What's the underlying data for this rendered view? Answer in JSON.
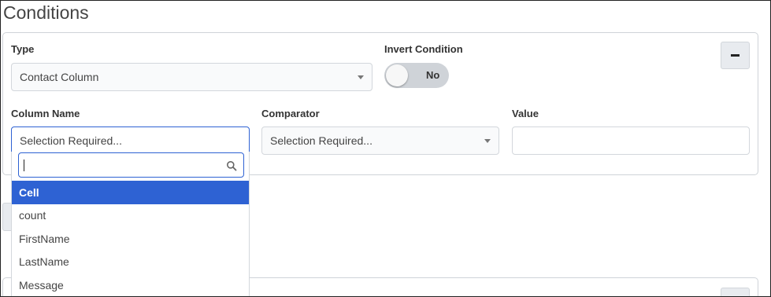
{
  "page": {
    "title": "Conditions"
  },
  "condition": {
    "type_label": "Type",
    "type_value": "Contact Column",
    "invert_label": "Invert Condition",
    "invert_value": "No",
    "column_name_label": "Column Name",
    "column_name_value": "Selection Required...",
    "comparator_label": "Comparator",
    "comparator_value": "Selection Required...",
    "value_label": "Value",
    "value_value": ""
  },
  "dropdown": {
    "search_value": "",
    "items": [
      {
        "label": "Cell",
        "selected": true
      },
      {
        "label": "count",
        "selected": false
      },
      {
        "label": "FirstName",
        "selected": false
      },
      {
        "label": "LastName",
        "selected": false
      },
      {
        "label": "Message",
        "selected": false
      }
    ]
  },
  "colors": {
    "accent": "#2e62d3",
    "border": "#cfd3d8",
    "button_bg": "#e8ebef"
  }
}
